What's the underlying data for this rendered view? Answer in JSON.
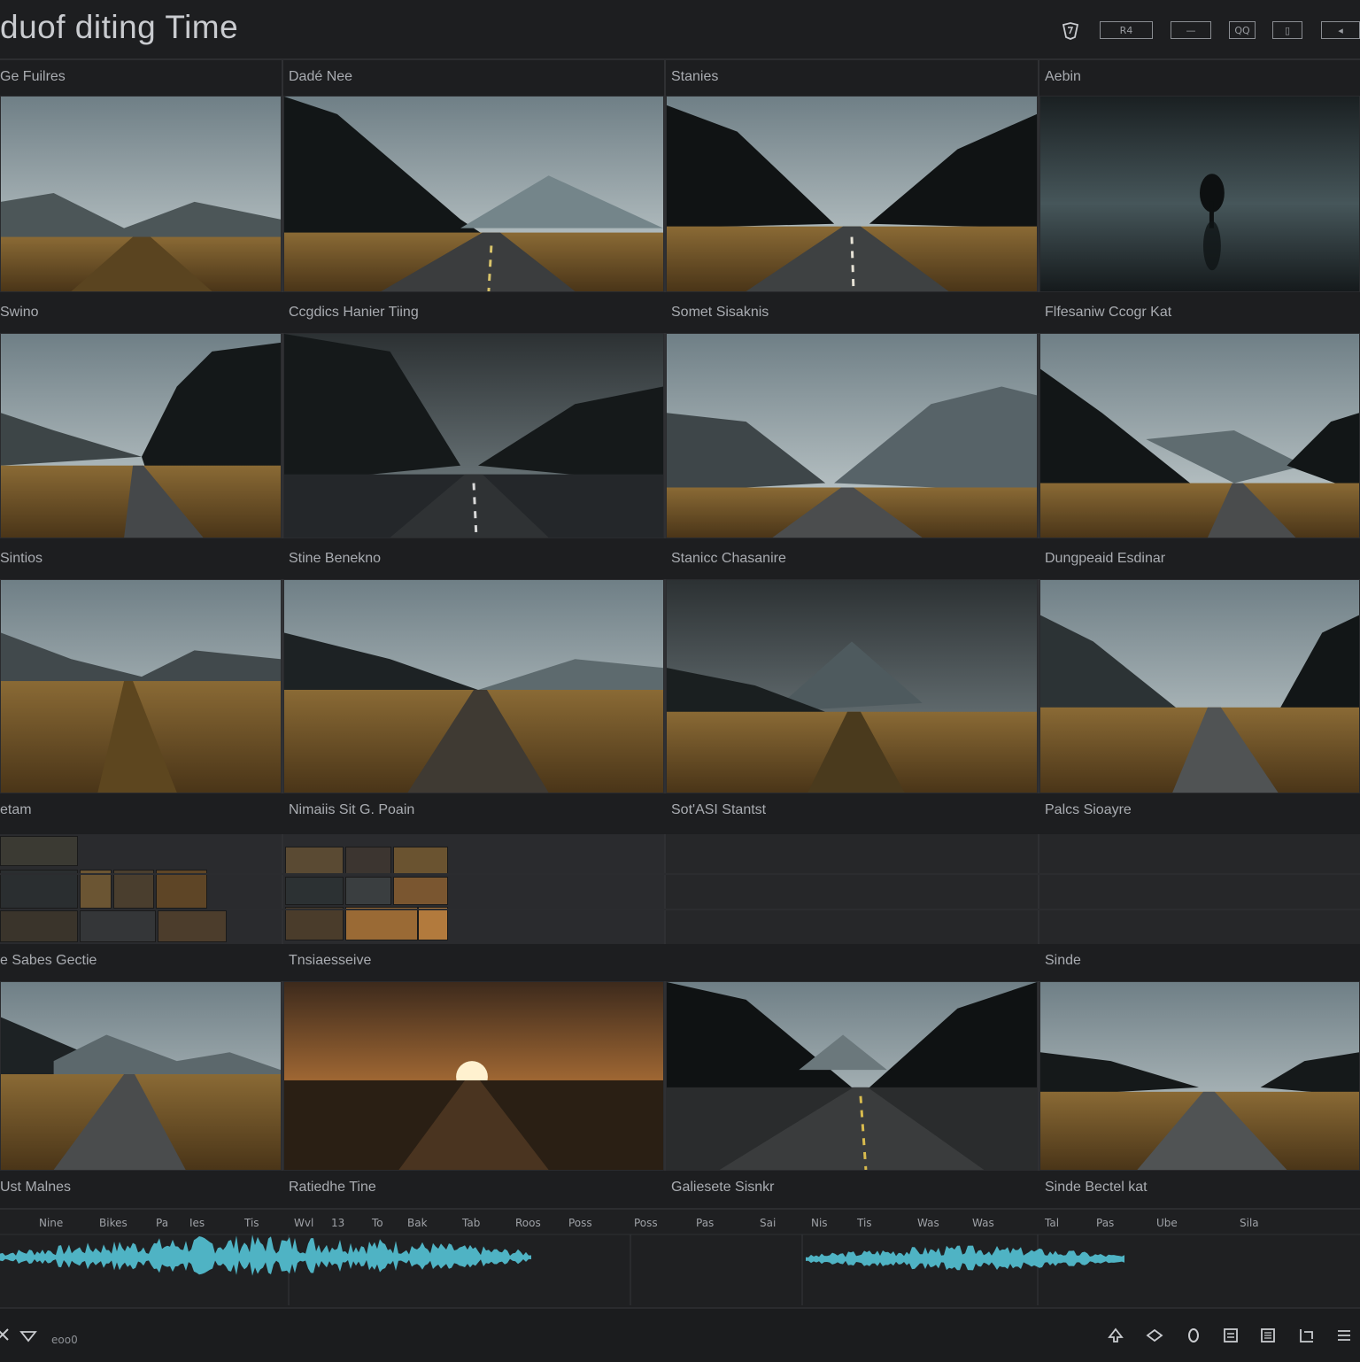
{
  "app": {
    "title": "duof diting Time"
  },
  "toolbar": {
    "logo_icon": "logo-icon",
    "buttons": [
      {
        "label": "R4",
        "icon": "record-icon"
      },
      {
        "label": "—",
        "icon": "zoom-icon"
      },
      {
        "label": "QQ",
        "icon": "loop-icon"
      },
      {
        "label": "▯",
        "icon": "panel-icon"
      },
      {
        "label": "◂",
        "icon": "audio-icon"
      }
    ]
  },
  "columns": {
    "headers": [
      "Ge Fuilres",
      "Dadé Nee",
      "Stanies",
      "Aebin"
    ]
  },
  "rows": [
    {
      "labels": [
        "Swino",
        "Ccgdics Hanier Tiing",
        "Somet Sisaknis",
        "Flfesaniw Ccogr Kat"
      ]
    },
    {
      "labels": [
        "Sintios",
        "Stine Benekno",
        "Stanicc Chasanire",
        "Dungpeaid Esdinar"
      ]
    },
    {
      "labels": [
        "etam",
        "Nimaiis Sit G. Poain",
        "Sot'ASI Stantst",
        "Palcs Sioayre"
      ]
    },
    {
      "labels": [
        "e Sabes Gectie",
        "Tnsiaesseive",
        "",
        "Sinde"
      ]
    },
    {
      "labels": [
        "Ust Malnes",
        "Ratiedhe Tine",
        "Galiesete Sisnkr",
        "Sinde Bectel kat"
      ]
    }
  ],
  "timeline": {
    "ticks": [
      "Nine",
      "Bikes",
      "Pa",
      "Ies",
      "Tis",
      "Wvl",
      "13",
      "To",
      "Bak",
      "Tab",
      "Roos",
      "Poss",
      "Poss",
      "Pas",
      "Sai",
      "Nis",
      "Tis",
      "Was",
      "Was",
      "Tal",
      "Pas",
      "Ube",
      "Sila"
    ]
  },
  "bottombar": {
    "status": "eoo0",
    "icons": [
      "close-icon",
      "send-icon",
      "up-arrow-icon",
      "share-icon",
      "record-icon",
      "grid-icon",
      "list-icon",
      "export-icon"
    ]
  },
  "colors": {
    "background": "#1c1d1f",
    "waveform": "#4fb3c4",
    "grass": "#b07d33"
  }
}
